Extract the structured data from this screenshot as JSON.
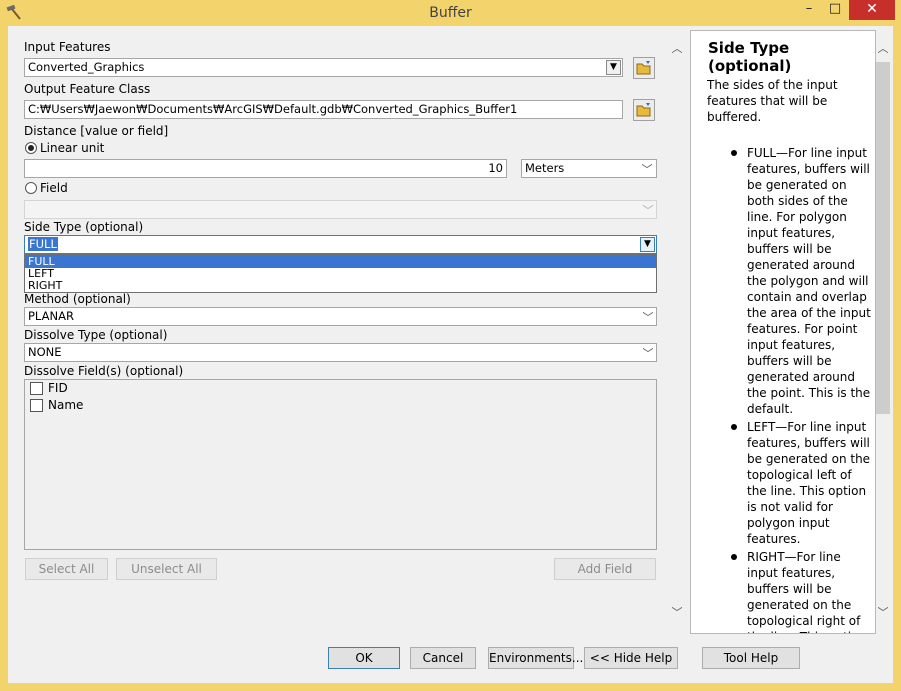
{
  "window": {
    "title": "Buffer",
    "minimize": "–",
    "maximize": "□",
    "close": "✕"
  },
  "form": {
    "input_features": {
      "label": "Input Features",
      "value": "Converted_Graphics"
    },
    "output_feature_class": {
      "label": "Output Feature Class",
      "value": "C:₩Users₩Jaewon₩Documents₩ArcGIS₩Default.gdb₩Converted_Graphics_Buffer1"
    },
    "distance": {
      "label": "Distance [value or field]",
      "linear_unit_label": "Linear unit",
      "value": "10",
      "unit": "Meters",
      "field_label": "Field",
      "field_value": ""
    },
    "side_type": {
      "label": "Side Type (optional)",
      "value": "FULL",
      "options": [
        "FULL",
        "LEFT",
        "RIGHT"
      ]
    },
    "method": {
      "label": "Method (optional)",
      "value": "PLANAR"
    },
    "dissolve_type": {
      "label": "Dissolve Type (optional)",
      "value": "NONE"
    },
    "dissolve_fields": {
      "label": "Dissolve Field(s) (optional)",
      "fields": [
        "FID",
        "Name"
      ]
    },
    "select_all": "Select All",
    "unselect_all": "Unselect All",
    "add_field": "Add Field"
  },
  "help": {
    "title": "Side Type (optional)",
    "intro": "The sides of the input features that will be buffered.",
    "items": [
      "FULL—For line input features, buffers will be generated on both sides of the line. For polygon input features, buffers will be generated around the polygon and will contain and overlap the area of the input features. For point input features, buffers will be generated around the point. This is the default.",
      "LEFT—For line input features, buffers will be generated on the topological left of the line. This option is not valid for polygon input features.",
      "RIGHT—For line input features, buffers will be generated on the topological right of the line. This option is not valid for"
    ]
  },
  "footer": {
    "ok": "OK",
    "cancel": "Cancel",
    "environments": "Environments...",
    "hide_help": "<< Hide Help",
    "tool_help": "Tool Help"
  },
  "icons": {
    "app": "hammer-icon",
    "folder": "folder-open-icon"
  }
}
